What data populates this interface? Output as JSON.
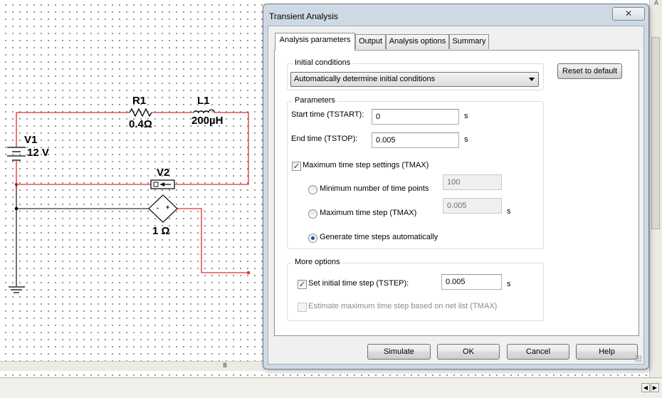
{
  "schematic": {
    "components": {
      "v1": {
        "name": "V1",
        "value": "12 V"
      },
      "r1": {
        "name": "R1",
        "value": "0.4Ω"
      },
      "l1": {
        "name": "L1",
        "value": "200µH"
      },
      "v2": {
        "name": "V2",
        "value": "1 Ω"
      }
    },
    "wire_color": "#e03030",
    "ground_wire_color": "#000000",
    "v2_pins": {
      "minus": "-",
      "plus": "+"
    }
  },
  "dialog": {
    "title": "Transient Analysis",
    "close_glyph": "✕",
    "tabs": [
      {
        "label": "Analysis parameters",
        "active": true
      },
      {
        "label": "Output",
        "active": false
      },
      {
        "label": "Analysis options",
        "active": false
      },
      {
        "label": "Summary",
        "active": false
      }
    ],
    "initial_conditions": {
      "legend": "Initial conditions",
      "selected": "Automatically determine initial conditions"
    },
    "reset_button": "Reset to default",
    "parameters": {
      "legend": "Parameters",
      "start_time": {
        "label": "Start time (TSTART):",
        "value": "0",
        "unit": "s"
      },
      "end_time": {
        "label": "End time (TSTOP):",
        "value": "0.005",
        "unit": "s"
      },
      "tmax_settings": {
        "label": "Maximum time step settings (TMAX)",
        "checked": true
      },
      "min_points": {
        "label": "Minimum number of time points",
        "value": "100",
        "selected": false
      },
      "max_step": {
        "label": "Maximum time step (TMAX)",
        "value": "0.005",
        "unit": "s",
        "selected": false
      },
      "auto_steps": {
        "label": "Generate time steps automatically",
        "selected": true
      }
    },
    "more_options": {
      "legend": "More options",
      "initial_step": {
        "label": "Set initial time step (TSTEP):",
        "value": "0.005",
        "unit": "s",
        "checked": true
      },
      "estimate": {
        "label": "Estimate maximum time step based on net list (TMAX)",
        "checked": false
      }
    },
    "buttons": {
      "simulate": "Simulate",
      "ok": "OK",
      "cancel": "Cancel",
      "help": "Help"
    },
    "check_glyph": "✓"
  },
  "scroll": {
    "h_grip": "III",
    "left_arrow": "◀",
    "right_arrow": "▶",
    "top_arrow": "A"
  }
}
